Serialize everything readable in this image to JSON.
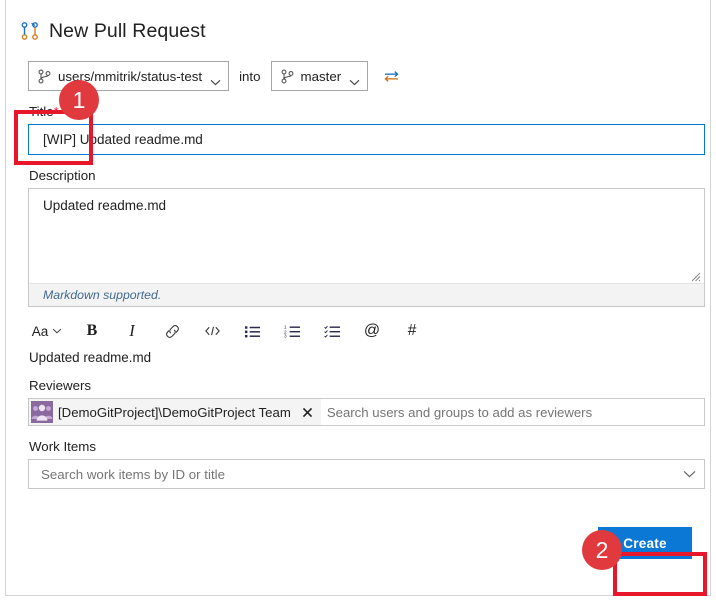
{
  "header": {
    "icon": "pull-request-icon",
    "title": "New Pull Request"
  },
  "branch_row": {
    "source_branch": "users/mmitrik/status-test",
    "source_icon": "branch-icon",
    "into_label": "into",
    "target_branch": "master",
    "target_icon": "branch-icon",
    "swap_icon": "swap-arrows-icon"
  },
  "title_field": {
    "label": "Title",
    "required_marker": "*",
    "value": "[WIP] Updated readme.md",
    "wip_prefix": "[WIP]",
    "focus_color": "#0078d4"
  },
  "description_field": {
    "label": "Description",
    "value": "Updated readme.md",
    "markdown_note": "Markdown supported."
  },
  "markdown_toolbar": {
    "buttons": [
      {
        "name": "font-size-icon",
        "label": "Aa"
      },
      {
        "name": "bold-icon",
        "label": "B"
      },
      {
        "name": "italic-icon",
        "label": "I"
      },
      {
        "name": "link-icon",
        "label": ""
      },
      {
        "name": "code-icon",
        "label": ""
      },
      {
        "name": "bulleted-list-icon",
        "label": ""
      },
      {
        "name": "numbered-list-icon",
        "label": ""
      },
      {
        "name": "task-list-icon",
        "label": ""
      },
      {
        "name": "mention-icon",
        "label": "@"
      },
      {
        "name": "hashtag-icon",
        "label": "#"
      }
    ]
  },
  "preview": {
    "text": "Updated readme.md"
  },
  "reviewers_field": {
    "label": "Reviewers",
    "chip": {
      "avatar_icon": "team-avatar-icon",
      "avatar_color": "#8a6a9e",
      "name": "[DemoGitProject]\\DemoGitProject Team",
      "remove_icon": "close-icon"
    },
    "placeholder": "Search users and groups to add as reviewers"
  },
  "work_items_field": {
    "label": "Work Items",
    "placeholder": "Search work items by ID or title",
    "chevron_icon": "chevron-down-icon"
  },
  "actions": {
    "create_label": "Create",
    "create_color": "#0a78d4"
  },
  "annotations": {
    "badge_color": "#e03a3e",
    "box_color": "#e8162b",
    "items": [
      {
        "number": "1",
        "target": "wip-title-prefix"
      },
      {
        "number": "2",
        "target": "create-button"
      }
    ]
  }
}
